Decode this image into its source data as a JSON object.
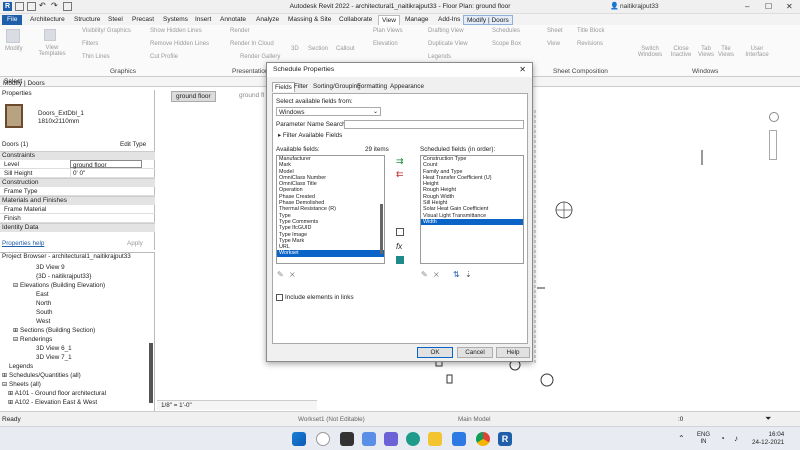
{
  "window": {
    "title": "Autodesk Revit 2022 - architectural1_naitikrajput33 - Floor Plan: ground floor",
    "user": "naitikrajput33"
  },
  "ribbon_tabs": [
    "File",
    "Architecture",
    "Structure",
    "Steel",
    "Precast",
    "Systems",
    "Insert",
    "Annotate",
    "Analyze",
    "Massing & Site",
    "Collaborate",
    "View",
    "Manage",
    "Add-Ins",
    "Modify | Doors"
  ],
  "ribbon": {
    "modify": "Modify",
    "view_templates": "View Templates",
    "visibility_graphics": "Visibility/ Graphics",
    "filters": "Filters",
    "thin_lines": "Thin Lines",
    "show_hidden_lines": "Show Hidden Lines",
    "remove_hidden_lines": "Remove Hidden Lines",
    "cut_profile": "Cut Profile",
    "render": "Render",
    "render_in_cloud": "Render In Cloud",
    "render_gallery": "Render Gallery",
    "threeD": "3D",
    "section": "Section",
    "callout": "Callout",
    "plan_views": "Plan Views",
    "elevation": "Elevation",
    "drafting_view": "Drafting View",
    "duplicate_view": "Duplicate View",
    "legends": "Legends",
    "schedules": "Schedules",
    "scope_box": "Scope Box",
    "sheet": "Sheet",
    "view": "View",
    "title_block": "Title Block",
    "revisions": "Revisions",
    "switch_windows": "Switch Windows",
    "close_inactive": "Close Inactive",
    "tab_views": "Tab Views",
    "tile_views": "Tile Views",
    "user_interface": "User Interface",
    "panel_graphics": "Graphics",
    "panel_presentation": "Presentation",
    "panel_sheet_composition": "Sheet Composition",
    "panel_windows": "Windows"
  },
  "optionbar": {
    "select": "Select",
    "context": "Modify | Doors"
  },
  "properties": {
    "header": "Properties",
    "type_name": "Doors_ExtDbl_1",
    "type_size": "1810x2110mm",
    "selector": "Doors (1)",
    "edit_type": "Edit Type",
    "sections": {
      "constraints": "Constraints",
      "construction": "Construction",
      "materials": "Materials and Finishes",
      "identity": "Identity Data"
    },
    "rows": {
      "level_k": "Level",
      "level_v": "ground floor",
      "sill_k": "Sill Height",
      "sill_v": "0'  0\"",
      "frame_type": "Frame Type",
      "frame_material": "Frame Material",
      "finish": "Finish"
    },
    "help": "Properties help",
    "apply": "Apply"
  },
  "project_browser": {
    "header": "Project Browser - architectural1_naitikrajput33",
    "items": [
      "3D View 9",
      "{3D - naitikrajput33}",
      "Elevations (Building Elevation)",
      "East",
      "North",
      "South",
      "West",
      "Sections (Building Section)",
      "Renderings",
      "3D View 6_1",
      "3D View 7_1",
      "Legends",
      "Schedules/Quantities (all)",
      "Sheets (all)",
      "A101 - Ground floor architectural",
      "A102 - Elevation East & West"
    ]
  },
  "view_tabs": [
    "ground floor",
    "ground fl"
  ],
  "dialog": {
    "title": "Schedule Properties",
    "tabs": [
      "Fields",
      "Filter",
      "Sorting/Grouping",
      "Formatting",
      "Appearance"
    ],
    "select_from_label": "Select available fields from:",
    "select_from_value": "Windows",
    "param_search_label": "Parameter Name Search:",
    "filter_fields": "Filter Available Fields",
    "available_label": "Available fields:",
    "items_count": "29 items",
    "available_fields": [
      "Manufacturer",
      "Mark",
      "Model",
      "OmniClass Number",
      "OmniClass Title",
      "Operation",
      "Phase Created",
      "Phase Demolished",
      "Thermal Resistance (R)",
      "Type",
      "Type Comments",
      "Type IfcGUID",
      "Type Image",
      "Type Mark",
      "URL",
      "Workset"
    ],
    "scheduled_label": "Scheduled fields (in order):",
    "scheduled_fields": [
      "Construction Type",
      "Count",
      "Family and Type",
      "Heat Transfer Coefficient (U)",
      "Height",
      "Rough Height",
      "Rough Width",
      "Sill Height",
      "Solar Heat Gain Coefficient",
      "Visual Light Transmittance",
      "Width"
    ],
    "include_linked": "Include elements in links",
    "ok": "OK",
    "cancel": "Cancel",
    "help": "Help"
  },
  "statusbar": {
    "ready": "Ready",
    "scale": "1/8\" = 1'-0\"",
    "workset": "Workset1 (Not Editable)",
    "model": "Main Model",
    "zero": ":0"
  },
  "taskbar": {
    "lang": "ENG",
    "region": "IN",
    "time": "16:04",
    "date": "24-12-2021"
  },
  "colors": {
    "accent": "#1f5ea8",
    "selection": "#0a64c8"
  }
}
